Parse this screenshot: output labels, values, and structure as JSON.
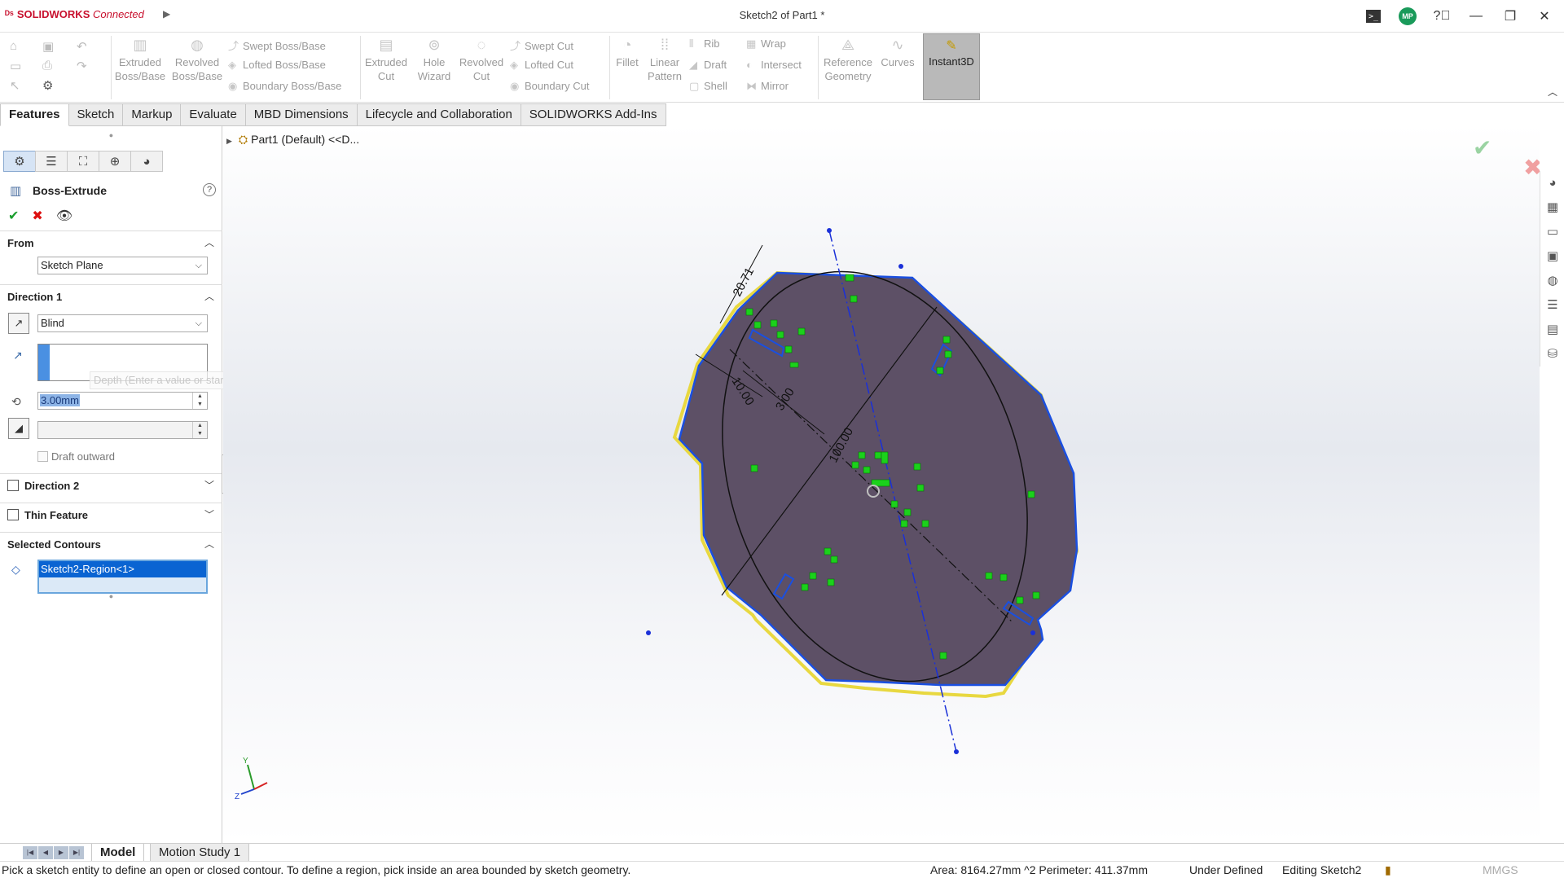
{
  "app": {
    "brand": "SOLIDWORKS",
    "brand_suffix": "Connected",
    "document_title": "Sketch2 of Part1 *",
    "user_initials": "MP",
    "title_icons": [
      "terminal-icon",
      "help-icon",
      "minimize-icon",
      "restore-icon",
      "close-icon"
    ]
  },
  "ribbon": {
    "extruded_boss": "Extruded\nBoss/Base",
    "revolved_boss": "Revolved\nBoss/Base",
    "swept_boss": "Swept Boss/Base",
    "lofted_boss": "Lofted Boss/Base",
    "boundary_boss": "Boundary Boss/Base",
    "extruded_cut": "Extruded\nCut",
    "hole_wizard": "Hole\nWizard",
    "revolved_cut": "Revolved\nCut",
    "swept_cut": "Swept Cut",
    "lofted_cut": "Lofted Cut",
    "boundary_cut": "Boundary Cut",
    "fillet": "Fillet",
    "linear_pattern": "Linear\nPattern",
    "rib": "Rib",
    "draft": "Draft",
    "shell": "Shell",
    "wrap": "Wrap",
    "intersect": "Intersect",
    "mirror": "Mirror",
    "reference_geometry": "Reference\nGeometry",
    "curves": "Curves",
    "instant3d": "Instant3D"
  },
  "tabs": [
    "Features",
    "Sketch",
    "Markup",
    "Evaluate",
    "MBD Dimensions",
    "Lifecycle and Collaboration",
    "SOLIDWORKS Add-Ins"
  ],
  "feature": {
    "title": "Boss-Extrude",
    "from_label": "From",
    "from_value": "Sketch Plane",
    "direction1_label": "Direction 1",
    "end_condition": "Blind",
    "depth_value": "3.00mm",
    "depth_tooltip": "Depth (Enter a value or start with = to create an equation)",
    "draft_outward": "Draft outward",
    "direction2_label": "Direction 2",
    "thin_feature_label": "Thin Feature",
    "selected_contours_label": "Selected Contours",
    "contour_item": "Sketch2-Region<1>"
  },
  "viewport": {
    "tree_root": "Part1 (Default) <<D...",
    "dimensions": [
      "20.71",
      "10.00",
      "3.00",
      "100.00"
    ],
    "triad_axes": [
      "Y",
      "Z"
    ]
  },
  "bottom_tabs": [
    "Model",
    "Motion Study 1"
  ],
  "status": {
    "hint": "Pick a sketch entity to define an open or closed contour. To define a region, pick inside an area bounded by sketch geometry.",
    "measure": "Area: 8164.27mm ^2 Perimeter: 411.37mm",
    "definition": "Under Defined",
    "editing": "Editing Sketch2",
    "units": "MMGS"
  },
  "colors": {
    "brand_red": "#c8102e",
    "region_fill": "#5d5066",
    "sketch_blue": "#1a4fe0",
    "selection_blue": "#0a64d2",
    "relation_green": "#1bd11b"
  }
}
